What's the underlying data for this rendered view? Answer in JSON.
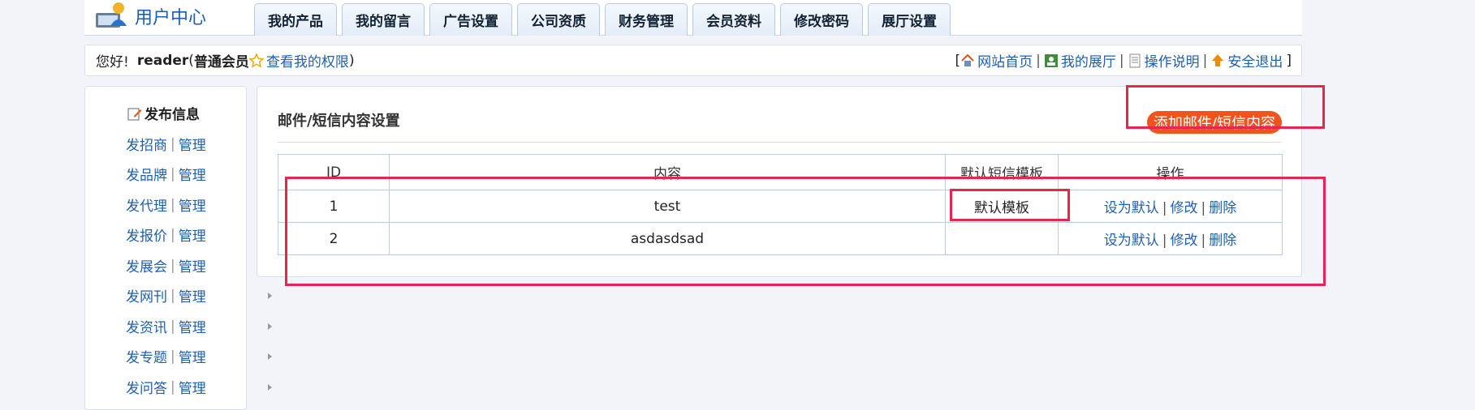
{
  "header": {
    "logo_text": "用户中心",
    "tabs": [
      "我的产品",
      "我的留言",
      "广告设置",
      "公司资质",
      "财务管理",
      "会员资料",
      "修改密码",
      "展厅设置"
    ]
  },
  "userbar": {
    "greeting": "您好!",
    "username": "reader",
    "member_level": "普通会员",
    "permission_link": "查看我的权限",
    "links": [
      "网站首页",
      "我的展厅",
      "操作说明",
      "安全退出"
    ]
  },
  "sidebar": {
    "title": "发布信息",
    "items": [
      {
        "publish": "发招商",
        "manage": "管理"
      },
      {
        "publish": "发品牌",
        "manage": "管理"
      },
      {
        "publish": "发代理",
        "manage": "管理"
      },
      {
        "publish": "发报价",
        "manage": "管理"
      },
      {
        "publish": "发展会",
        "manage": "管理"
      },
      {
        "publish": "发网刊",
        "manage": "管理"
      },
      {
        "publish": "发资讯",
        "manage": "管理"
      },
      {
        "publish": "发专题",
        "manage": "管理"
      },
      {
        "publish": "发问答",
        "manage": "管理"
      }
    ]
  },
  "panel": {
    "title": "邮件/短信内容设置",
    "add_button": "添加邮件/短信内容",
    "columns": [
      "ID",
      "内容",
      "默认短信模板",
      "操作"
    ],
    "rows": [
      {
        "id": "1",
        "content": "test",
        "default": "默认模板",
        "actions": [
          "设为默认",
          "修改",
          "删除"
        ]
      },
      {
        "id": "2",
        "content": "asdasdsad",
        "default": "",
        "actions": [
          "设为默认",
          "修改",
          "删除"
        ]
      }
    ]
  },
  "colors": {
    "accent_blue": "#1f5fae",
    "add_button_bg": "#f0531c",
    "highlight_red": "#e8264d",
    "page_bg": "#f2f4f9"
  }
}
